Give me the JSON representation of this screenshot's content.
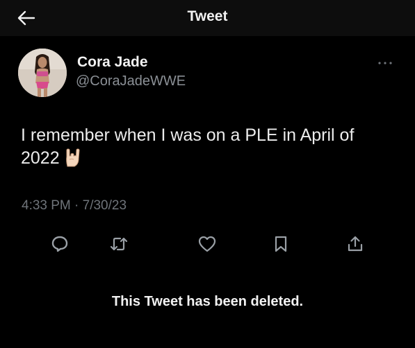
{
  "header": {
    "title": "Tweet",
    "back_icon": "arrow-left-icon"
  },
  "tweet": {
    "author": {
      "display_name": "Cora Jade",
      "handle": "@CoraJadeWWE",
      "avatar": "avatar-photo"
    },
    "more_icon": "ellipsis-icon",
    "text": "I remember when I was on a PLE in April of 2022",
    "emoji": "rock-on-hand-emoji",
    "timestamp": "4:33 PM · 7/30/23",
    "actions": [
      {
        "name": "reply",
        "icon": "reply-icon"
      },
      {
        "name": "retweet",
        "icon": "retweet-icon"
      },
      {
        "name": "like",
        "icon": "heart-icon"
      },
      {
        "name": "bookmark",
        "icon": "bookmark-icon"
      },
      {
        "name": "share",
        "icon": "share-icon"
      }
    ]
  },
  "notice": {
    "deleted_text": "This Tweet has been deleted."
  },
  "colors": {
    "background": "#000000",
    "topbar": "#0d0d0d",
    "primary_text": "#e7e9ea",
    "secondary_text": "#8b9096",
    "icon": "#9aa0a6"
  }
}
